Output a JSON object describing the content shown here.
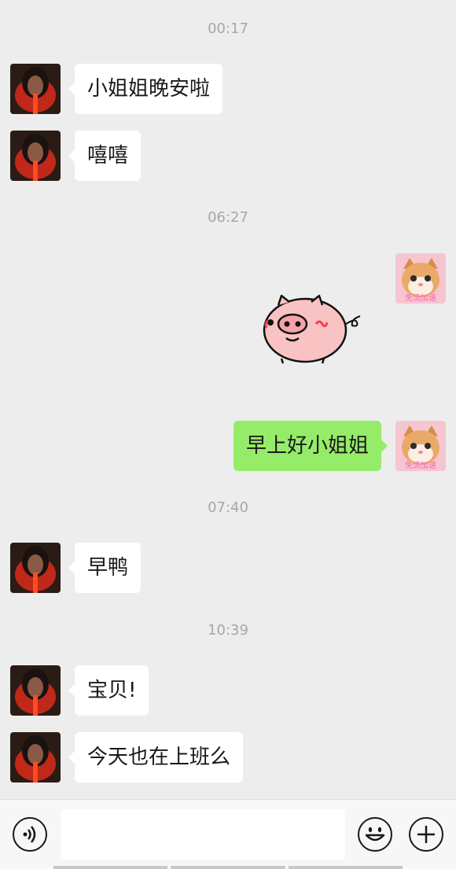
{
  "messages": {
    "t1": "00:17",
    "m1": "小姐姐晚安啦",
    "m2": "嘻嘻",
    "t2": "06:27",
    "sticker": "pig-sticker",
    "m3": "早上好小姐姐",
    "t3": "07:40",
    "m4": "早鸭",
    "t4": "10:39",
    "m5": "宝贝!",
    "m6": "今天也在上班么"
  },
  "avatar": {
    "me_badge": "免流加速"
  },
  "input_bar": {
    "value": "",
    "icons": [
      "voice-icon",
      "emoji-icon",
      "plus-icon"
    ]
  },
  "colors": {
    "background": "#ededed",
    "my_bubble": "#95ec69",
    "their_bubble": "#ffffff",
    "timestamp": "#a7a7a7"
  }
}
